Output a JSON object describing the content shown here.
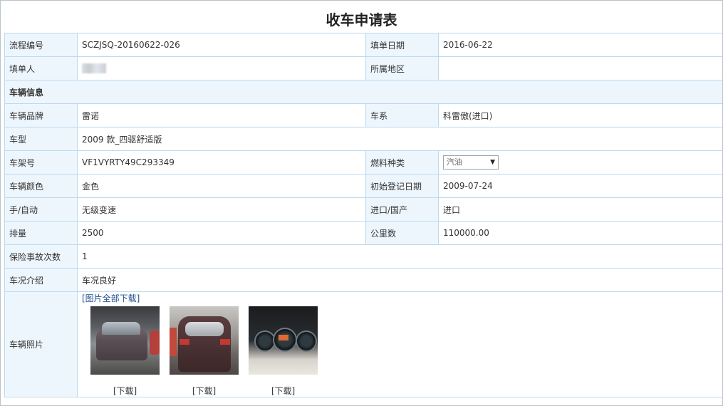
{
  "title": "收车申请表",
  "rows": {
    "process_no": {
      "label": "流程编号",
      "value": "SCZJSQ-20160622-026"
    },
    "fill_date": {
      "label": "填单日期",
      "value": "2016-06-22"
    },
    "filler": {
      "label": "填单人",
      "value": ""
    },
    "region": {
      "label": "所属地区",
      "value": ""
    },
    "section_vehicle": "车辆信息",
    "brand": {
      "label": "车辆品牌",
      "value": "雷诺"
    },
    "series": {
      "label": "车系",
      "value": "科雷傲(进口)"
    },
    "model": {
      "label": "车型",
      "value": "2009 款_四驱舒适版"
    },
    "vin": {
      "label": "车架号",
      "value": "VF1VYRTY49C293349"
    },
    "fuel": {
      "label": "燃料种类",
      "selected": "汽油"
    },
    "color": {
      "label": "车辆颜色",
      "value": "金色"
    },
    "first_reg": {
      "label": "初始登记日期",
      "value": "2009-07-24"
    },
    "transmission": {
      "label": "手/自动",
      "value": "无级变速"
    },
    "import": {
      "label": "进口/国产",
      "value": "进口"
    },
    "displacement": {
      "label": "排量",
      "value": "2500"
    },
    "mileage": {
      "label": "公里数",
      "value": "110000.00"
    },
    "accidents": {
      "label": "保险事故次数",
      "value": "1"
    },
    "condition": {
      "label": "车况介绍",
      "value": "车况良好"
    },
    "photos": {
      "label": "车辆照片",
      "download_all": "[图片全部下载]",
      "items": [
        {
          "download": "[下载]"
        },
        {
          "download": "[下载]"
        },
        {
          "download": "[下载]"
        }
      ]
    }
  },
  "colors": {
    "label_bg": "#eef6fd",
    "border": "#bcd9ee",
    "link": "#1f4e8c"
  }
}
